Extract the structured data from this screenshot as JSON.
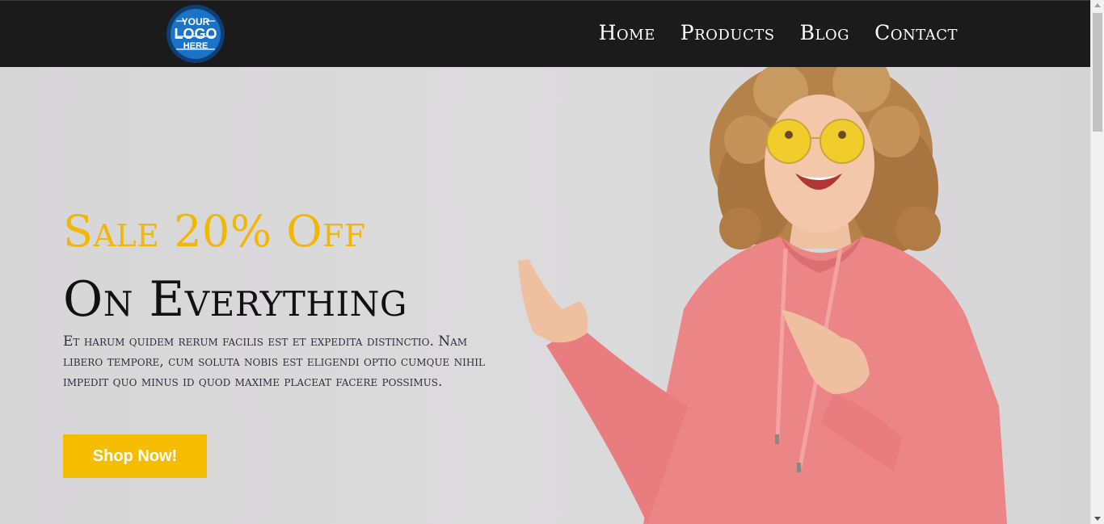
{
  "header": {
    "logo": {
      "line1": "YOUR",
      "line2": "LOGO",
      "line3": "HERE"
    },
    "nav": [
      "Home",
      "Products",
      "Blog",
      "Contact"
    ]
  },
  "hero": {
    "headline_1": "Sale 20% Off",
    "headline_2": "On Everything",
    "body": "Et harum quidem rerum facilis est et expedita distinctio. Nam libero tempore, cum soluta nobis est eligendi optio cumque nihil impedit quo minus id quod maxime placeat facere possimus.",
    "cta_label": "Shop Now!",
    "photo": "woman-in-pink-hoodie-pointing"
  },
  "colors": {
    "header_bg": "#1b1b1b",
    "accent_yellow": "#f5bd00",
    "headline_yellow": "#f2b705",
    "hero_bg": "#d9d8d9",
    "hoodie_pink": "#ec8585"
  }
}
